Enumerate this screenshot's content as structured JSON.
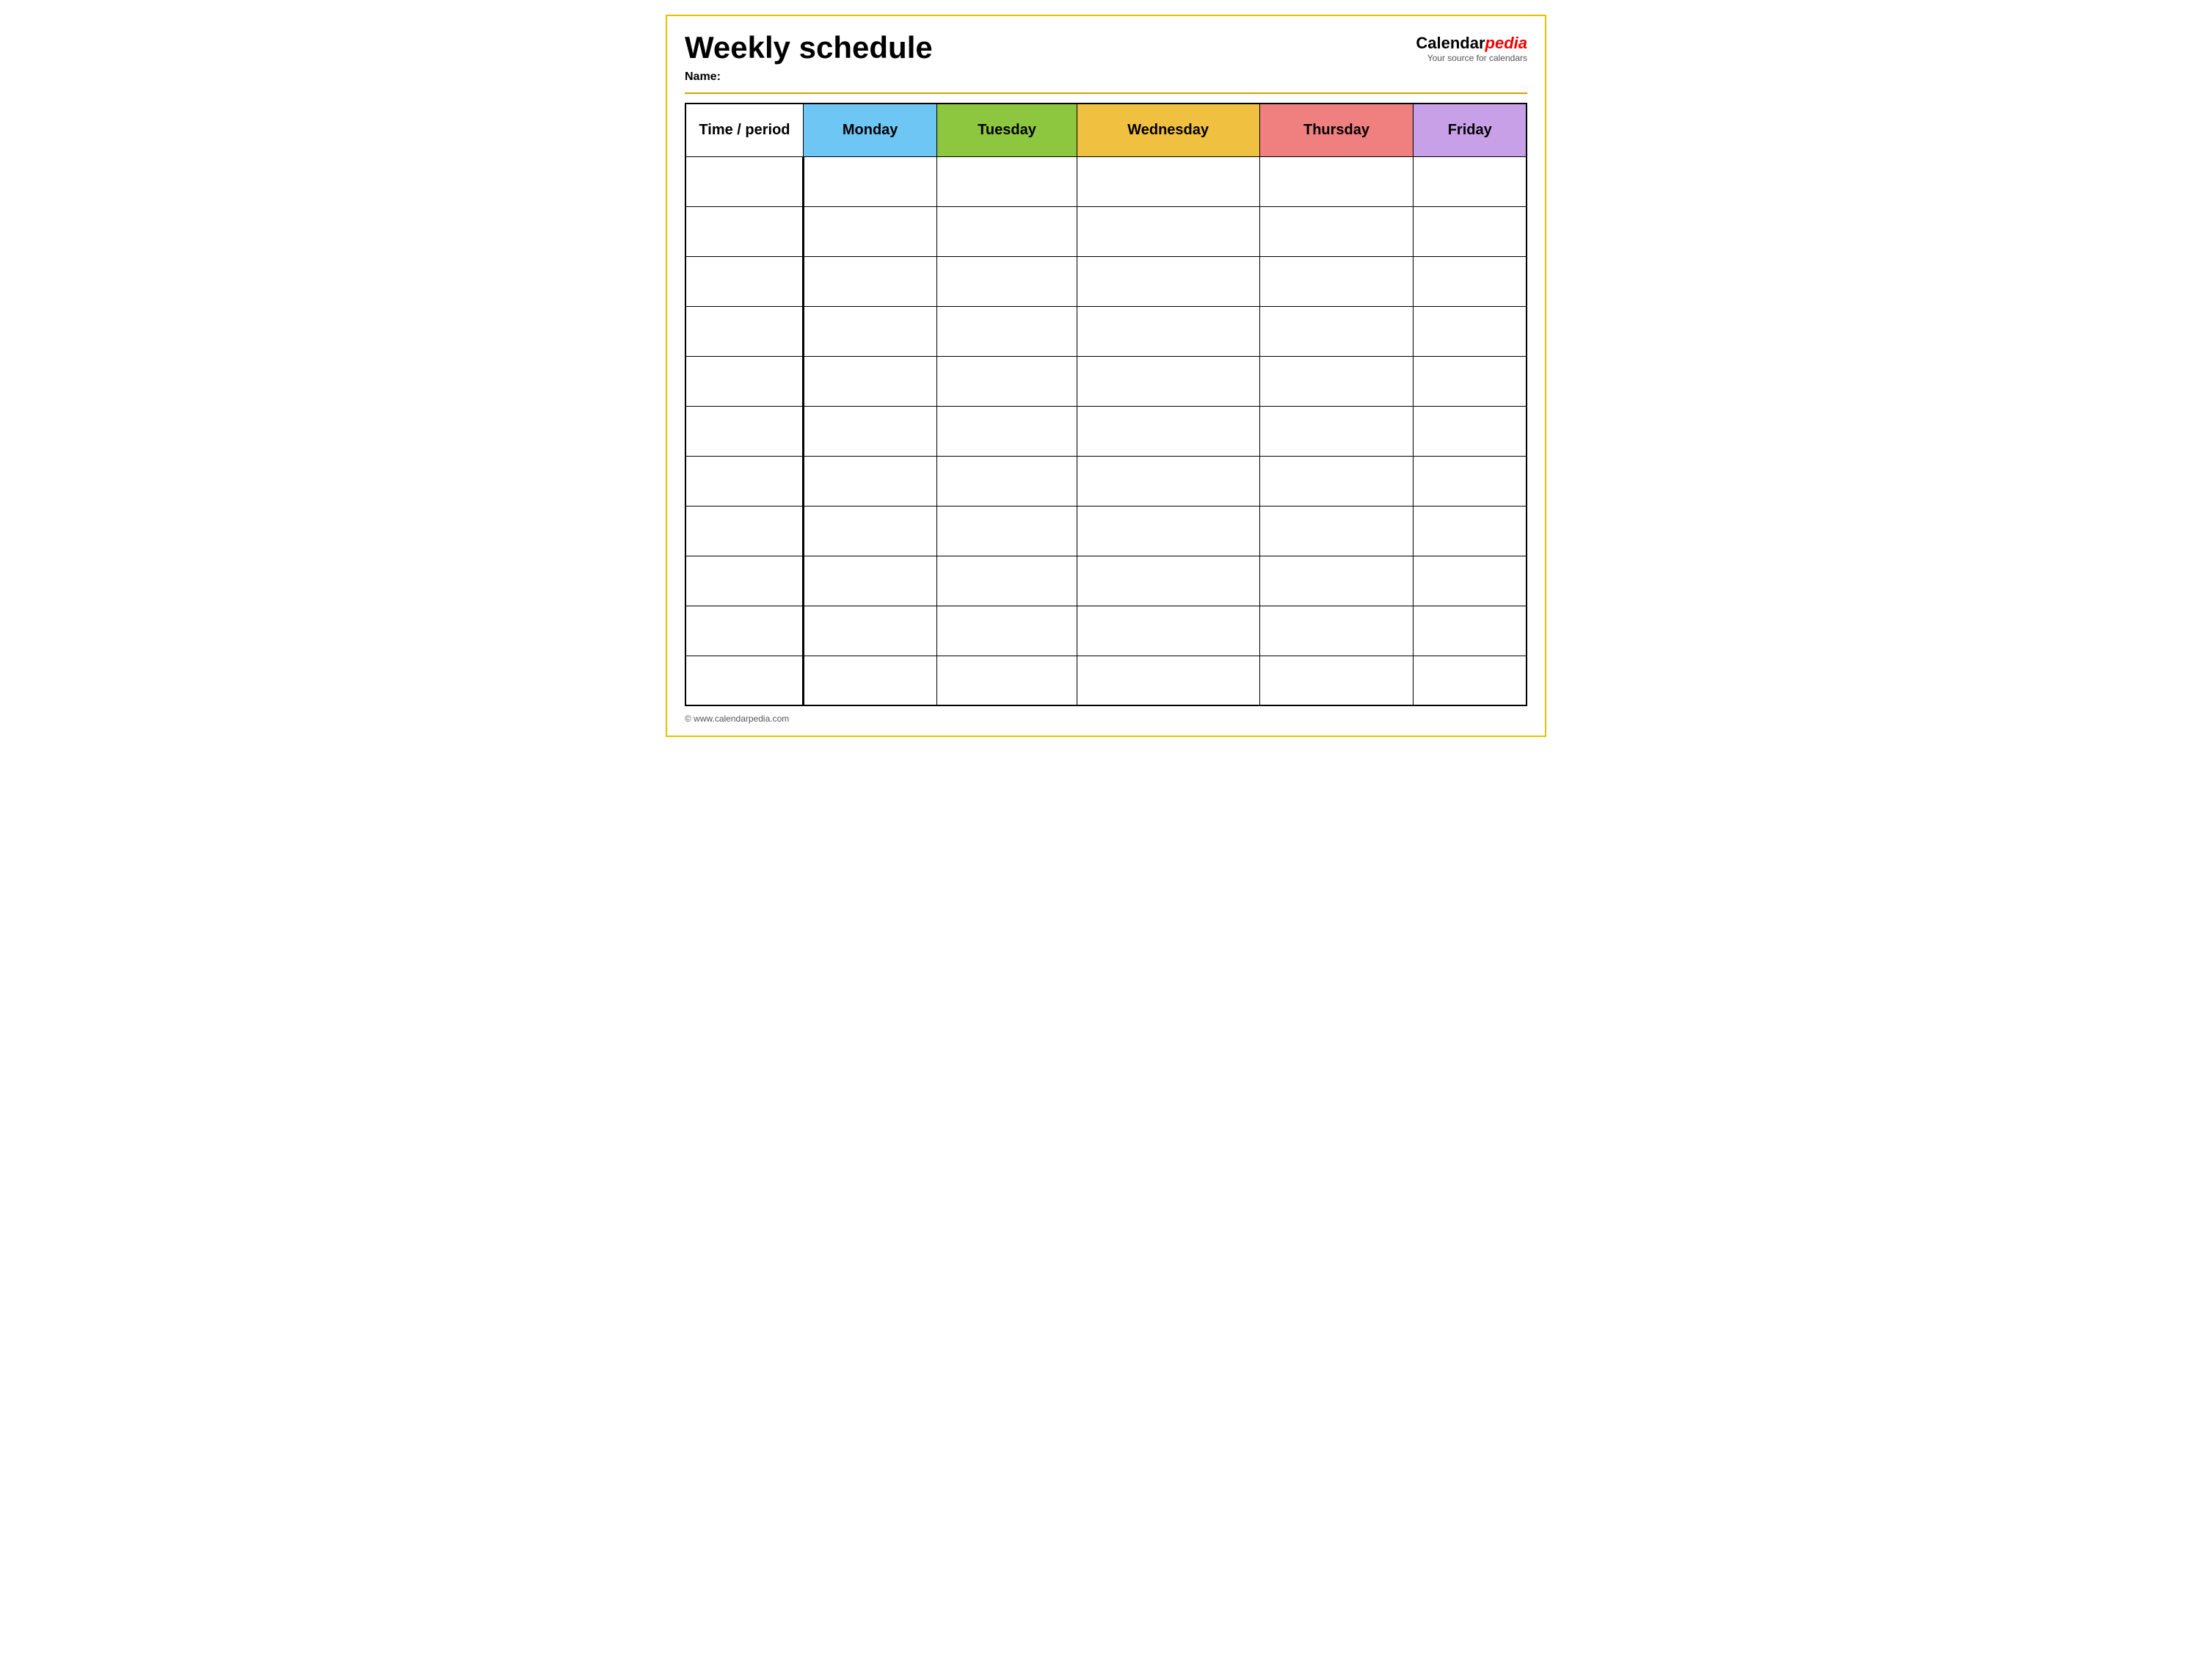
{
  "page": {
    "title": "Weekly schedule",
    "name_label": "Name:",
    "footer": "© www.calendarpedia.com"
  },
  "logo": {
    "brand_part1": "Calendar",
    "brand_italic": "pedia",
    "subtitle": "Your source for calendars"
  },
  "table": {
    "headers": [
      {
        "id": "time",
        "label": "Time / period",
        "color": "#fff",
        "class": "th-time"
      },
      {
        "id": "monday",
        "label": "Monday",
        "color": "#6ec6f5",
        "class": "th-monday"
      },
      {
        "id": "tuesday",
        "label": "Tuesday",
        "color": "#8dc63f",
        "class": "th-tuesday"
      },
      {
        "id": "wednesday",
        "label": "Wednesday",
        "color": "#f0c040",
        "class": "th-wednesday"
      },
      {
        "id": "thursday",
        "label": "Thursday",
        "color": "#f08080",
        "class": "th-thursday"
      },
      {
        "id": "friday",
        "label": "Friday",
        "color": "#c8a0e8",
        "class": "th-friday"
      }
    ],
    "rows": 11
  }
}
